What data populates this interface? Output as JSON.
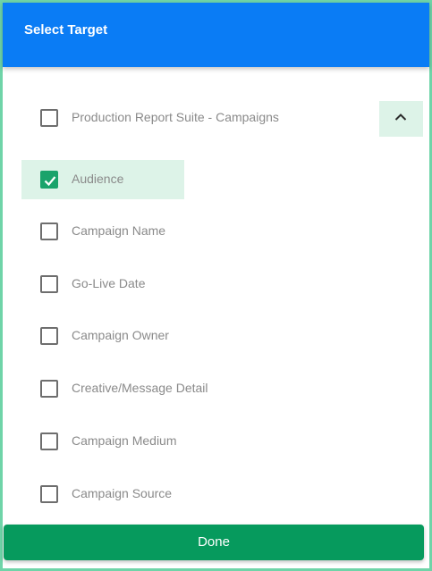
{
  "dialog": {
    "title": "Select Target",
    "accent_color": "#0a7cf5",
    "selected_bg": "#ddf3e8",
    "check_color": "#1aa36b"
  },
  "parent": {
    "label": "Production Report Suite - Campaigns",
    "checked": false,
    "expanded": true,
    "collapse_icon": "chevron-up-icon"
  },
  "items": [
    {
      "label": "Audience",
      "checked": true
    },
    {
      "label": "Campaign Name",
      "checked": false
    },
    {
      "label": "Go-Live Date",
      "checked": false
    },
    {
      "label": "Campaign Owner",
      "checked": false
    },
    {
      "label": "Creative/Message Detail",
      "checked": false
    },
    {
      "label": "Campaign Medium",
      "checked": false
    },
    {
      "label": "Campaign Source",
      "checked": false
    }
  ],
  "footer": {
    "done_label": "Done",
    "done_color": "#069a5d"
  }
}
